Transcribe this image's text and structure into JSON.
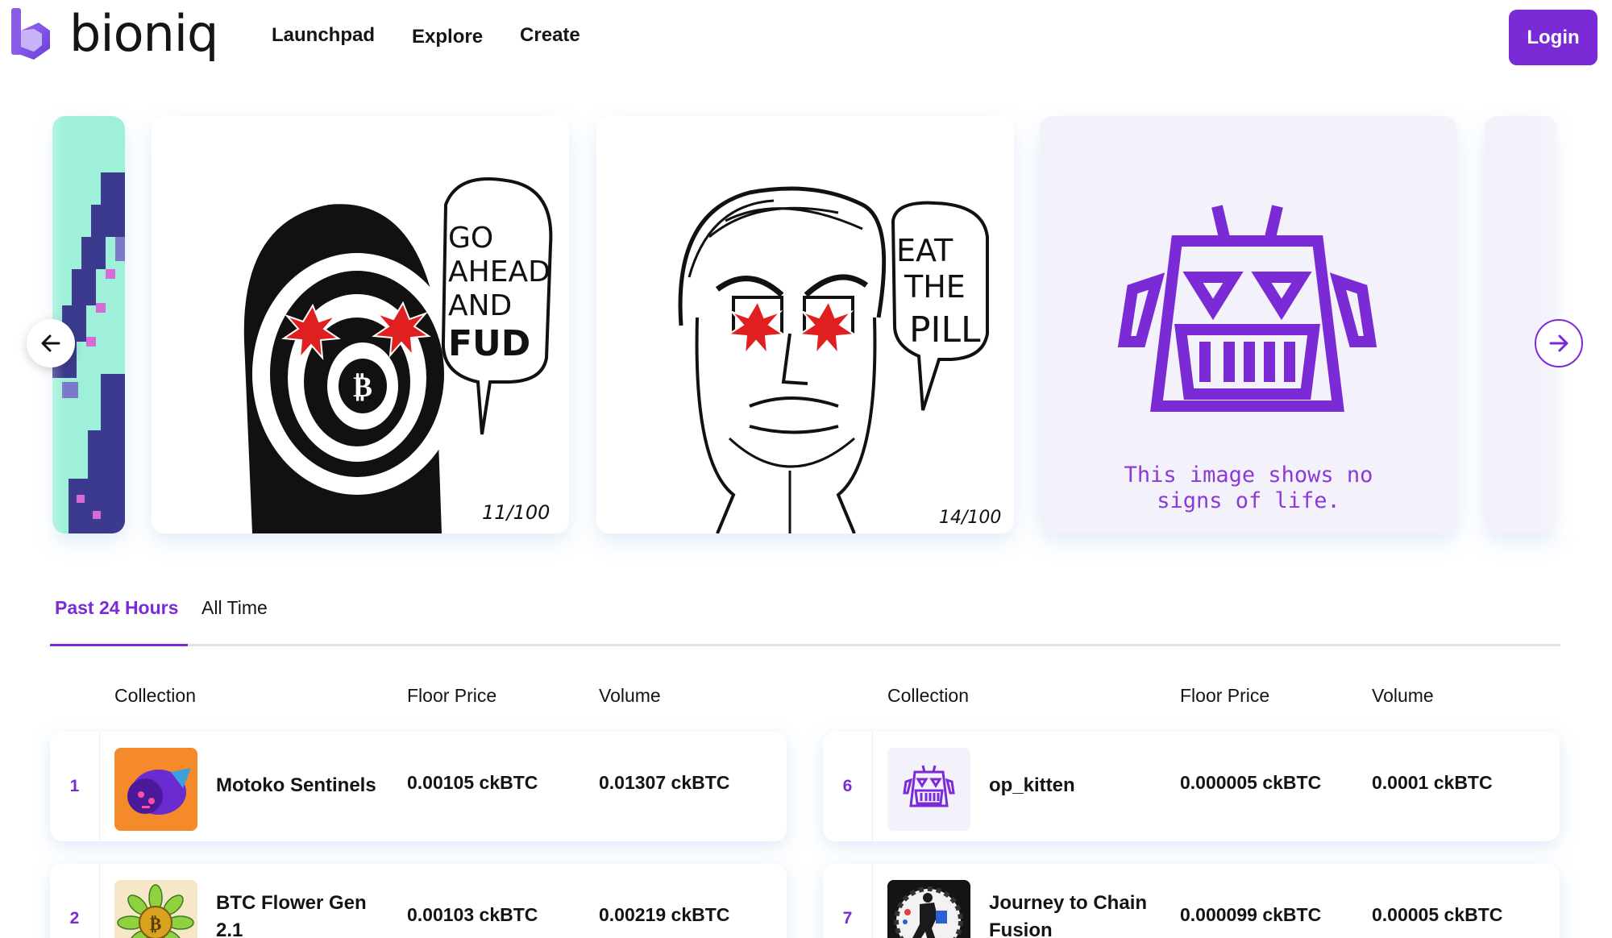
{
  "brand": {
    "name": "bioniq",
    "accent": "#7a2bd6"
  },
  "nav": {
    "items": [
      "Launchpad",
      "Explore",
      "Create"
    ]
  },
  "header": {
    "login_label": "Login"
  },
  "carousel": {
    "cards": [
      {
        "kind": "pixel-art"
      },
      {
        "kind": "comic",
        "speech": [
          "GO",
          "AHEAD",
          "AND",
          "FUD"
        ],
        "edition": "11/100"
      },
      {
        "kind": "comic",
        "speech": [
          "EAT",
          "THE",
          "PILL"
        ],
        "edition": "14/100"
      },
      {
        "kind": "placeholder",
        "caption_line1": "This image shows no",
        "caption_line2": "signs of life."
      }
    ],
    "prev_icon": "arrow-left-icon",
    "next_icon": "arrow-right-icon"
  },
  "tabs": [
    {
      "label": "Past 24 Hours",
      "active": true
    },
    {
      "label": "All Time",
      "active": false
    }
  ],
  "table": {
    "headers": {
      "collection": "Collection",
      "floor": "Floor Price",
      "volume": "Volume"
    },
    "left_rows": [
      {
        "rank": "1",
        "name": "Motoko Sentinels",
        "floor": "0.00105 ckBTC",
        "volume": "0.01307 ckBTC",
        "thumb": "motoko-thumb"
      },
      {
        "rank": "2",
        "name": "BTC Flower Gen 2.1",
        "floor": "0.00103 ckBTC",
        "volume": "0.00219 ckBTC",
        "thumb": "flower-thumb"
      }
    ],
    "right_rows": [
      {
        "rank": "6",
        "name": "op_kitten",
        "floor": "0.000005 ckBTC",
        "volume": "0.0001 ckBTC",
        "thumb": "robot-thumb"
      },
      {
        "rank": "7",
        "name": "Journey to Chain Fusion",
        "floor": "0.000099 ckBTC",
        "volume": "0.00005 ckBTC",
        "thumb": "journey-thumb"
      }
    ]
  }
}
